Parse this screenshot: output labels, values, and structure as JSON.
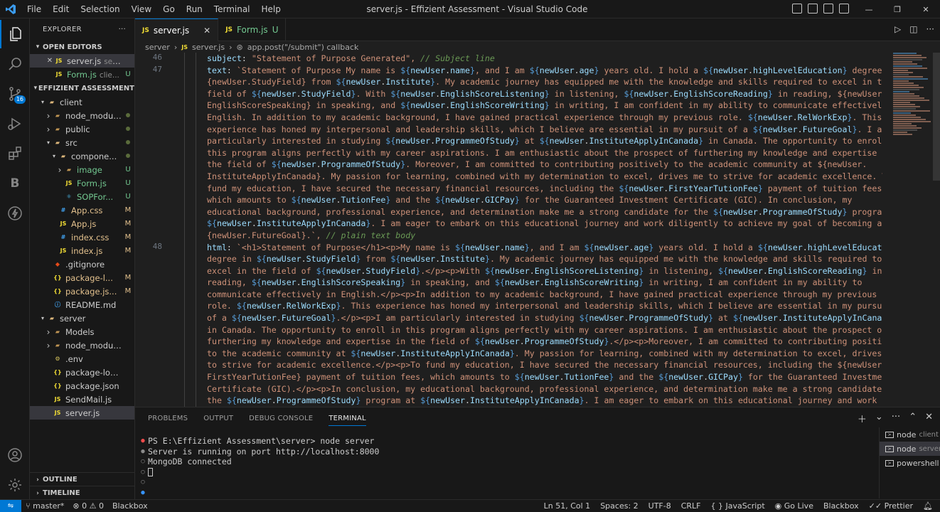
{
  "titlebar": {
    "menu": [
      "File",
      "Edit",
      "Selection",
      "View",
      "Go",
      "Run",
      "Terminal",
      "Help"
    ],
    "title": "server.js - Effizient Assessment - Visual Studio Code"
  },
  "activity": {
    "source_control_badge": "16",
    "blackbox_label": "B"
  },
  "sidebar": {
    "title": "EXPLORER",
    "open_editors_title": "OPEN EDITORS",
    "open_editors": [
      {
        "name": "server.js",
        "hint": "server",
        "status": "",
        "icon": "JS"
      },
      {
        "name": "Form.js",
        "hint": "clie...",
        "status": "U",
        "icon": "JS"
      }
    ],
    "project_title": "EFFIZIENT ASSESSMENT",
    "tree": [
      {
        "name": "client",
        "status": "",
        "type": "folder-open"
      },
      {
        "name": "node_modules",
        "status": "dot",
        "type": "folder"
      },
      {
        "name": "public",
        "status": "dot",
        "type": "folder"
      },
      {
        "name": "src",
        "status": "dot",
        "type": "folder-open"
      },
      {
        "name": "compone...",
        "status": "dot",
        "type": "folder-open"
      },
      {
        "name": "image",
        "status": "U",
        "type": "folder"
      },
      {
        "name": "Form.js",
        "status": "U",
        "type": "js"
      },
      {
        "name": "SOPFor...",
        "status": "U",
        "type": "react"
      },
      {
        "name": "App.css",
        "status": "M",
        "type": "css"
      },
      {
        "name": "App.js",
        "status": "M",
        "type": "js"
      },
      {
        "name": "index.css",
        "status": "M",
        "type": "css"
      },
      {
        "name": "index.js",
        "status": "M",
        "type": "js"
      },
      {
        "name": ".gitignore",
        "status": "",
        "type": "git"
      },
      {
        "name": "package-l...",
        "status": "M",
        "type": "json"
      },
      {
        "name": "package.js...",
        "status": "M",
        "type": "json"
      },
      {
        "name": "README.md",
        "status": "",
        "type": "md"
      },
      {
        "name": "server",
        "status": "",
        "type": "folder-open"
      },
      {
        "name": "Models",
        "status": "",
        "type": "folder"
      },
      {
        "name": "node_modules",
        "status": "",
        "type": "folder"
      },
      {
        "name": ".env",
        "status": "",
        "type": "env"
      },
      {
        "name": "package-lock.json",
        "status": "",
        "type": "json"
      },
      {
        "name": "package.json",
        "status": "",
        "type": "json"
      },
      {
        "name": "SendMail.js",
        "status": "",
        "type": "js"
      },
      {
        "name": "server.js",
        "status": "",
        "type": "js"
      }
    ],
    "outline_title": "OUTLINE",
    "timeline_title": "TIMELINE"
  },
  "tabs": [
    {
      "name": "server.js",
      "status": ""
    },
    {
      "name": "Form.js",
      "status": "U"
    }
  ],
  "breadcrumb": [
    "server",
    "server.js",
    "app.post(\"/submit\") callback"
  ],
  "editor": {
    "line_numbers": [
      {
        "n": "46",
        "row": 0
      },
      {
        "n": "47",
        "row": 1
      },
      {
        "n": "48",
        "row": 16
      }
    ],
    "lines": [
      "subject: \"Statement of Purpose Generated\", // Subject line",
      "text: `Statement of Purpose My name is ${newUser.name}, and I am ${newUser.age} years old. I hold a ${newUser.highLevelEducation} degree in $",
      "{newUser.StudyField} from ${newUser.Institute}. My academic journey has equipped me with the knowledge and skills required to excel in the",
      "field of ${newUser.StudyField}. With ${newUser.EnglishScoreListening} in listening, ${newUser.EnglishScoreReading} in reading, ${newUser.",
      "EnglishScoreSpeaking} in speaking, and ${newUser.EnglishScoreWriting} in writing, I am confident in my ability to communicate effectively in",
      "English. In addition to my academic background, I have gained practical experience through my previous role. ${newUser.RelWorkExp}. This",
      "experience has honed my interpersonal and leadership skills, which I believe are essential in my pursuit of a ${newUser.FutureGoal}. I am",
      "particularly interested in studying ${newUser.ProgrammeOfStudy} at ${newUser.InstituteApplyInCanada} in Canada. The opportunity to enroll in",
      "this program aligns perfectly with my career aspirations. I am enthusiastic about the prospect of furthering my knowledge and expertise in",
      "the field of ${newUser.ProgrammeOfStudy}. Moreover, I am committed to contributing positively to the academic community at ${newUser.",
      "InstituteApplyInCanada}. My passion for learning, combined with my determination to excel, drives me to strive for academic excellence. To",
      "fund my education, I have secured the necessary financial resources, including the ${newUser.FirstYearTutionFee} payment of tuition fees,",
      "which amounts to ${newUser.TutionFee} and the ${newUser.GICPay} for the Guaranteed Investment Certificate (GIC). In conclusion, my",
      "educational background, professional experience, and determination make me a strong candidate for the ${newUser.ProgrammeOfStudy} program at",
      "${newUser.InstituteApplyInCanada}. I am eager to embark on this educational journey and work diligently to achieve my goal of becoming an $",
      "{newUser.FutureGoal}.`, // plain text body",
      "html: `<h1>Statement of Purpose</h1><p>My name is ${newUser.name}, and I am ${newUser.age} years old. I hold a ${newUser.highLevelEducation}",
      "degree in ${newUser.StudyField} from ${newUser.Institute}. My academic journey has equipped me with the knowledge and skills required to",
      "excel in the field of ${newUser.StudyField}.</p><p>With ${newUser.EnglishScoreListening} in listening, ${newUser.EnglishScoreReading} in",
      "reading, ${newUser.EnglishScoreSpeaking} in speaking, and ${newUser.EnglishScoreWriting} in writing, I am confident in my ability to",
      "communicate effectively in English.</p><p>In addition to my academic background, I have gained practical experience through my previous",
      "role. ${newUser.RelWorkExp}. This experience has honed my interpersonal and leadership skills, which I believe are essential in my pursuit",
      "of a ${newUser.FutureGoal}.</p><p>I am particularly interested in studying ${newUser.ProgrammeOfStudy} at ${newUser.InstituteApplyInCanada}",
      "in Canada. The opportunity to enroll in this program aligns perfectly with my career aspirations. I am enthusiastic about the prospect of",
      "furthering my knowledge and expertise in the field of ${newUser.ProgrammeOfStudy}.</p><p>Moreover, I am committed to contributing positively",
      "to the academic community at ${newUser.InstituteApplyInCanada}. My passion for learning, combined with my determination to excel, drives me",
      "to strive for academic excellence.</p><p>To fund my education, I have secured the necessary financial resources, including the ${newUser.",
      "FirstYearTutionFee} payment of tuition fees, which amounts to ${newUser.TutionFee} and the ${newUser.GICPay} for the Guaranteed Investment",
      "Certificate (GIC).</p><p>In conclusion, my educational background, professional experience, and determination make me a strong candidate for",
      "the ${newUser.ProgrammeOfStudy} program at ${newUser.InstituteApplyInCanada}. I am eager to embark on this educational journey and work"
    ]
  },
  "panel": {
    "tabs": [
      "PROBLEMS",
      "OUTPUT",
      "DEBUG CONSOLE",
      "TERMINAL"
    ],
    "active_tab": "TERMINAL",
    "terminal_lines": [
      {
        "mark": "red",
        "text": "PS E:\\Effizient Assessment\\server> node server"
      },
      {
        "mark": "gray",
        "text": "Server is running on port http://localhost:8000"
      },
      {
        "mark": "none",
        "text": "MongoDB connected"
      },
      {
        "mark": "none",
        "text": ""
      }
    ],
    "terminals": [
      {
        "name": "node",
        "hint": "client"
      },
      {
        "name": "node",
        "hint": "server"
      },
      {
        "name": "powershell",
        "hint": ""
      }
    ]
  },
  "statusbar": {
    "branch": "master*",
    "problems": "0",
    "warnings": "0",
    "blackbox_left": "Blackbox",
    "position": "Ln 51, Col 1",
    "spaces": "Spaces: 2",
    "encoding": "UTF-8",
    "eol": "CRLF",
    "language": "JavaScript",
    "golive": "Go Live",
    "blackbox_right": "Blackbox",
    "prettier": "Prettier"
  }
}
